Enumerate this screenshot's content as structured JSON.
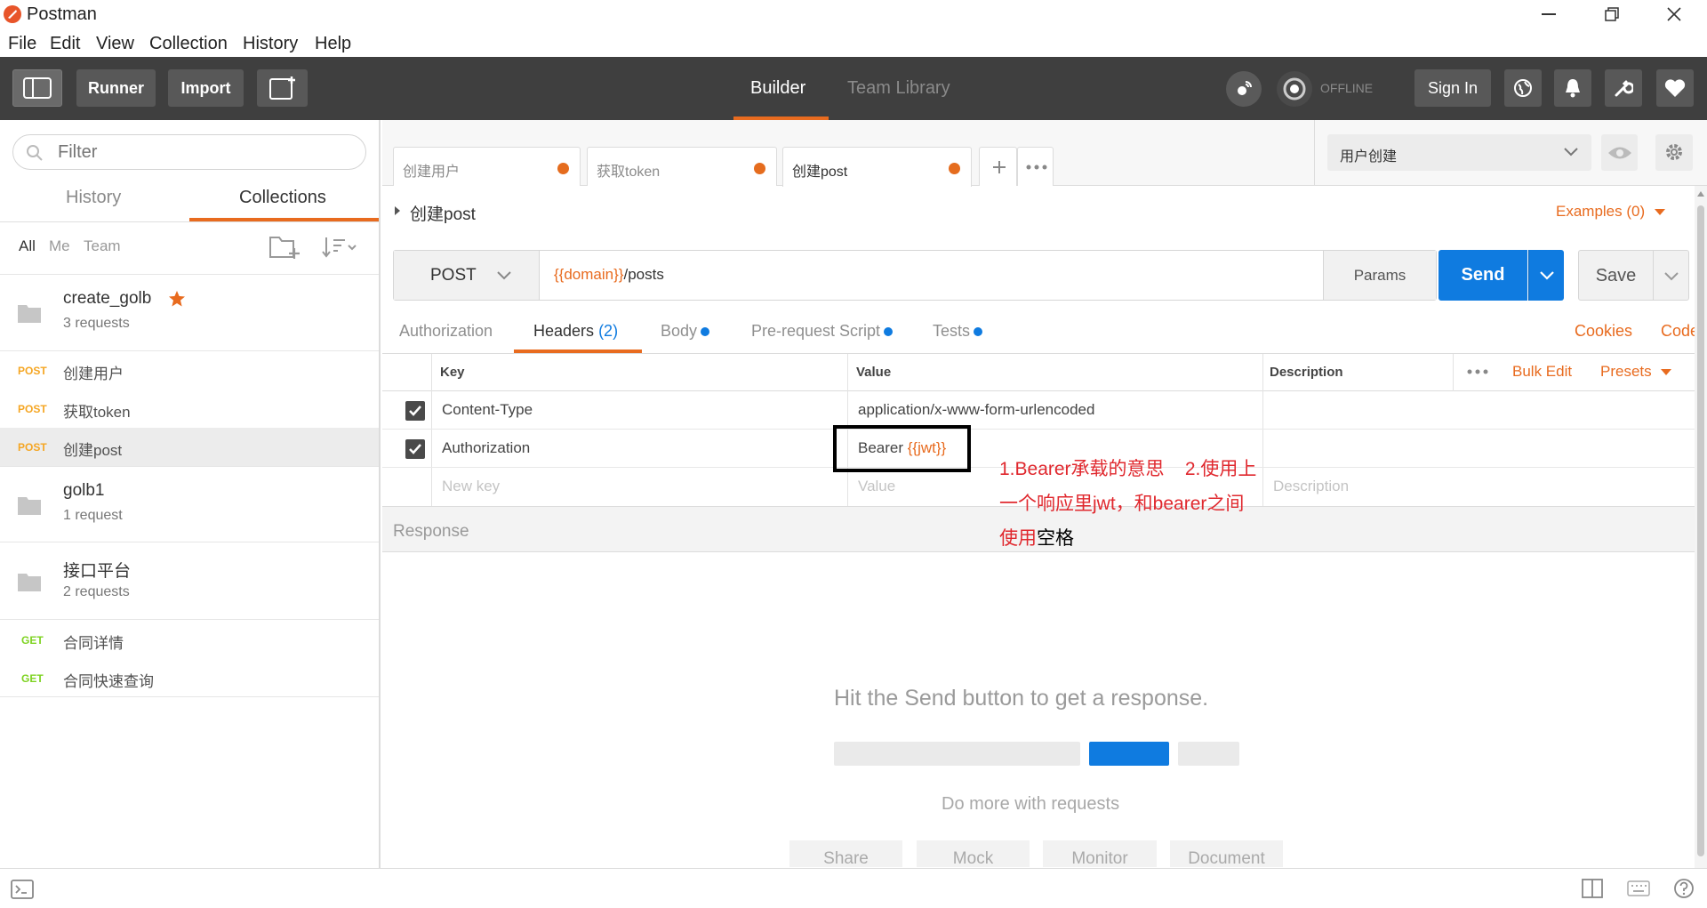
{
  "window": {
    "title": "Postman"
  },
  "menu": [
    "File",
    "Edit",
    "View",
    "Collection",
    "History",
    "Help"
  ],
  "toolbar": {
    "runner": "Runner",
    "import": "Import",
    "builder": "Builder",
    "team_library": "Team Library",
    "offline": "OFFLINE",
    "sign_in": "Sign In"
  },
  "sidebar": {
    "filter_placeholder": "Filter",
    "tab_history": "History",
    "tab_collections": "Collections",
    "scope": [
      "All",
      "Me",
      "Team"
    ],
    "collections": [
      {
        "name": "create_golb",
        "count": "3 requests",
        "starred": true
      },
      {
        "name": "golb1",
        "count": "1 request"
      },
      {
        "name": "接口平台",
        "count": "2 requests"
      }
    ],
    "requests_a": [
      {
        "method": "POST",
        "name": "创建用户"
      },
      {
        "method": "POST",
        "name": "获取token"
      },
      {
        "method": "POST",
        "name": "创建post"
      }
    ],
    "requests_c": [
      {
        "method": "GET",
        "name": "合同详情"
      },
      {
        "method": "GET",
        "name": "合同快速查询"
      }
    ]
  },
  "tabs": [
    "创建用户",
    "获取token",
    "创建post"
  ],
  "environment": "用户创建",
  "request": {
    "name": "创建post",
    "examples": "Examples (0)",
    "method": "POST",
    "url_var": "{{domain}}",
    "url_path": "/posts",
    "params": "Params",
    "send": "Send",
    "save": "Save"
  },
  "subtabs": {
    "authorization": "Authorization",
    "headers": "Headers",
    "headers_count": "(2)",
    "body": "Body",
    "prerequest": "Pre-request Script",
    "tests": "Tests",
    "cookies": "Cookies",
    "code": "Code"
  },
  "headers_table": {
    "col_key": "Key",
    "col_value": "Value",
    "col_desc": "Description",
    "bulk_edit": "Bulk Edit",
    "presets": "Presets",
    "rows": [
      {
        "key": "Content-Type",
        "value": "application/x-www-form-urlencoded",
        "checked": true
      },
      {
        "key": "Authorization",
        "value_prefix": "Bearer ",
        "value_var": "{{jwt}}",
        "checked": true
      }
    ],
    "new_key": "New key",
    "new_value": "Value",
    "new_desc": "Description"
  },
  "annotation": {
    "line1": "1.Bearer承载的意思    2.使用上",
    "line2": "一个响应里jwt，和bearer之间",
    "line3_red": "使用",
    "line3_black": "空格"
  },
  "response": {
    "label": "Response",
    "hint": "Hit the Send button to get a response.",
    "more": "Do more with requests",
    "actions": [
      "Share",
      "Mock",
      "Monitor",
      "Document"
    ]
  },
  "colors": {
    "accent": "#e86b1f",
    "send": "#0f7be0",
    "toolbar": "#3f3f3f",
    "post": "#f5a623",
    "get": "#7ed321",
    "annotation": "#e0282e"
  }
}
